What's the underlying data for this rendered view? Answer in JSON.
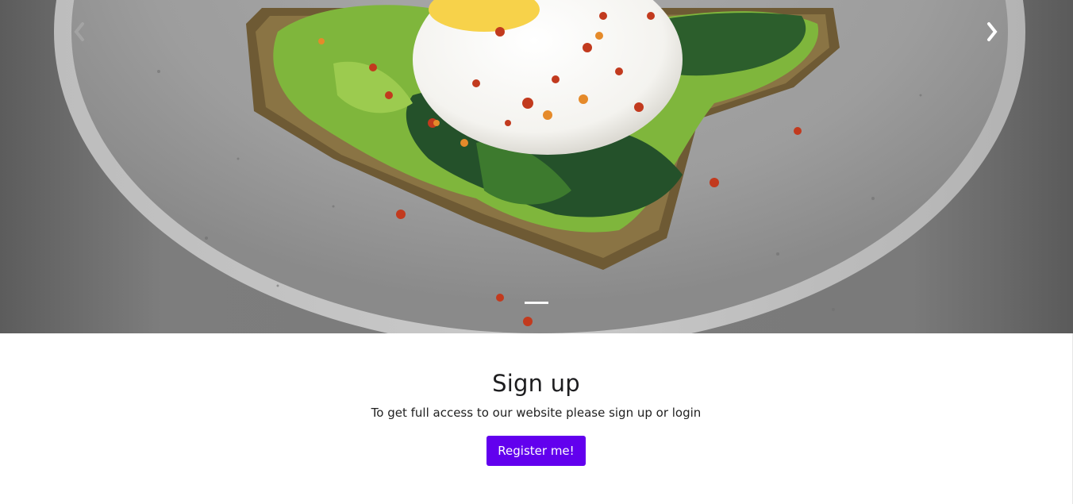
{
  "carousel": {
    "prev_icon": "chevron-left-icon",
    "next_icon": "chevron-right-icon",
    "active_slide": 1,
    "slide_count": 1
  },
  "signup": {
    "title": "Sign up",
    "text": "To get full access to our website please sign up or login",
    "button_label": "Register me!"
  },
  "colors": {
    "accent": "#6200ee",
    "text": "#212121",
    "background": "#ffffff"
  }
}
